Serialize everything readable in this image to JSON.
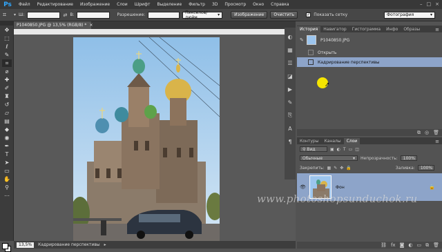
{
  "menubar": {
    "logo": "Ps",
    "items": [
      "Файл",
      "Редактирование",
      "Изображение",
      "Слои",
      "Шрифт",
      "Выделение",
      "Фильтр",
      "3D",
      "Просмотр",
      "Окно",
      "Справка"
    ],
    "window_buttons": [
      "–",
      "□",
      "×"
    ]
  },
  "options": {
    "width_label": "Ш:",
    "height_label": "В:",
    "resolution_label": "Разрешение:",
    "units_value": "Пикселов/дюйм",
    "image_button": "Изображение",
    "clear_button": "Очистить",
    "show_grid_label": "Показать сетку",
    "show_grid_checked": "✓",
    "preset_value": "Фотография"
  },
  "document": {
    "tab_title": "P1040850.JPG @ 13,5% (RGB/8) *",
    "tab_close": "×"
  },
  "status": {
    "zoom": "13,5%",
    "text": "Кадрирование перспективы"
  },
  "history_panel": {
    "tabs": [
      "История",
      "Навигатор",
      "Гистограмма",
      "Инфо",
      "Образы"
    ],
    "snapshot_label": "P1040850.JPG",
    "items": [
      "Открыть",
      "Кадрирование перспективы"
    ]
  },
  "layers_panel": {
    "tabs": [
      "Контуры",
      "Каналы",
      "Слои"
    ],
    "filter_value": "Вид",
    "blend_mode": "Обычные",
    "opacity_label": "Непрозрачность:",
    "opacity_value": "100%",
    "lock_label": "Закрепить:",
    "fill_label": "Заливка:",
    "fill_value": "100%",
    "layer_name": "Фон"
  },
  "watermark": "www.photoshopsunduchok.ru",
  "icons": {
    "tools": [
      "move-icon",
      "marquee-icon",
      "lasso-icon",
      "quick-select-icon",
      "crop-icon",
      "eyedropper-icon",
      "healing-icon",
      "brush-icon",
      "stamp-icon",
      "history-brush-icon",
      "eraser-icon",
      "gradient-icon",
      "blur-icon",
      "dodge-icon",
      "pen-icon",
      "type-icon",
      "path-select-icon",
      "shape-icon",
      "hand-icon",
      "zoom-icon"
    ]
  },
  "colors": {
    "selection": "#8da4c9",
    "accent": "#31a8ff"
  }
}
